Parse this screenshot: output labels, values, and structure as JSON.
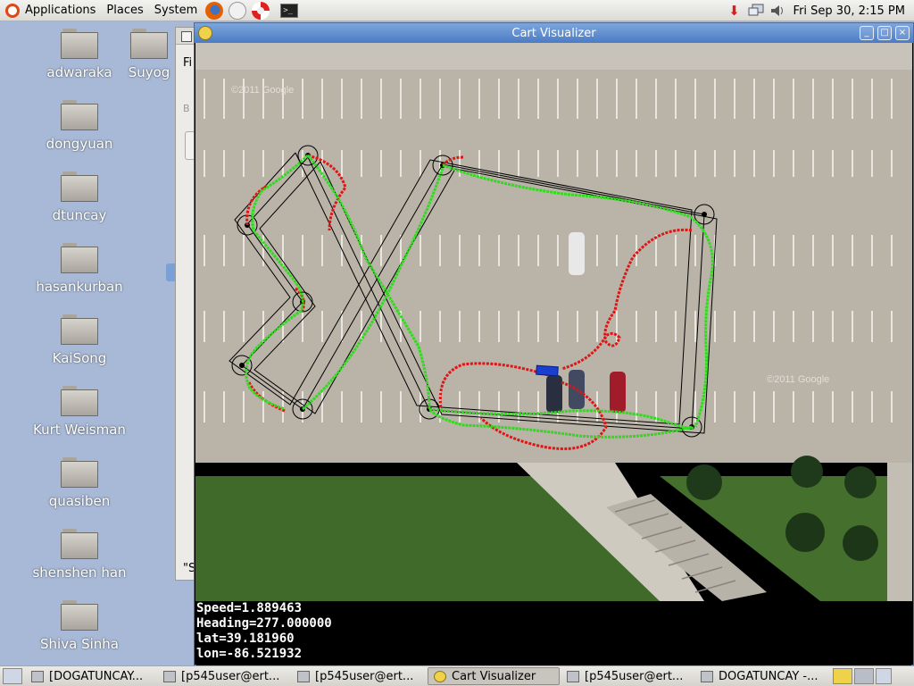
{
  "top_panel": {
    "menus": [
      "Applications",
      "Places",
      "System"
    ],
    "clock": "Fri Sep 30,  2:15 PM"
  },
  "desktop": {
    "icons": [
      "adwaraka",
      "Suyog",
      "dongyuan",
      "dtuncay",
      "hasankurban",
      "KaiSong",
      "Kurt Weisman",
      "quasiben",
      "shenshen han",
      "Shiva Sinha"
    ]
  },
  "back_window": {
    "fragments": [
      "Fi",
      "B",
      "\"S"
    ]
  },
  "cart_window": {
    "title": "Cart Visualizer",
    "buttons": {
      "minimize": "_",
      "maximize": "□",
      "close": "×"
    },
    "readout": {
      "speed": "Speed=1.889463",
      "heading": "Heading=277.000000",
      "lat": "lat=39.181960",
      "lon": "lon=-86.521932"
    },
    "map_watermarks": [
      "©2011 Google",
      "©2011 Google"
    ],
    "colors": {
      "planned_path": "#000000",
      "traveled_path": "#2ddc1a",
      "deviation_path": "#e01414",
      "cart_marker": "#1a3fd0"
    }
  },
  "taskbar": {
    "items": [
      {
        "label": "[DOGATUNCAY...",
        "active": false
      },
      {
        "label": "[p545user@ert...",
        "active": false
      },
      {
        "label": "[p545user@ert...",
        "active": false
      },
      {
        "label": "Cart Visualizer",
        "active": true
      },
      {
        "label": "[p545user@ert...",
        "active": false
      },
      {
        "label": "DOGATUNCAY -...",
        "active": false
      }
    ]
  }
}
